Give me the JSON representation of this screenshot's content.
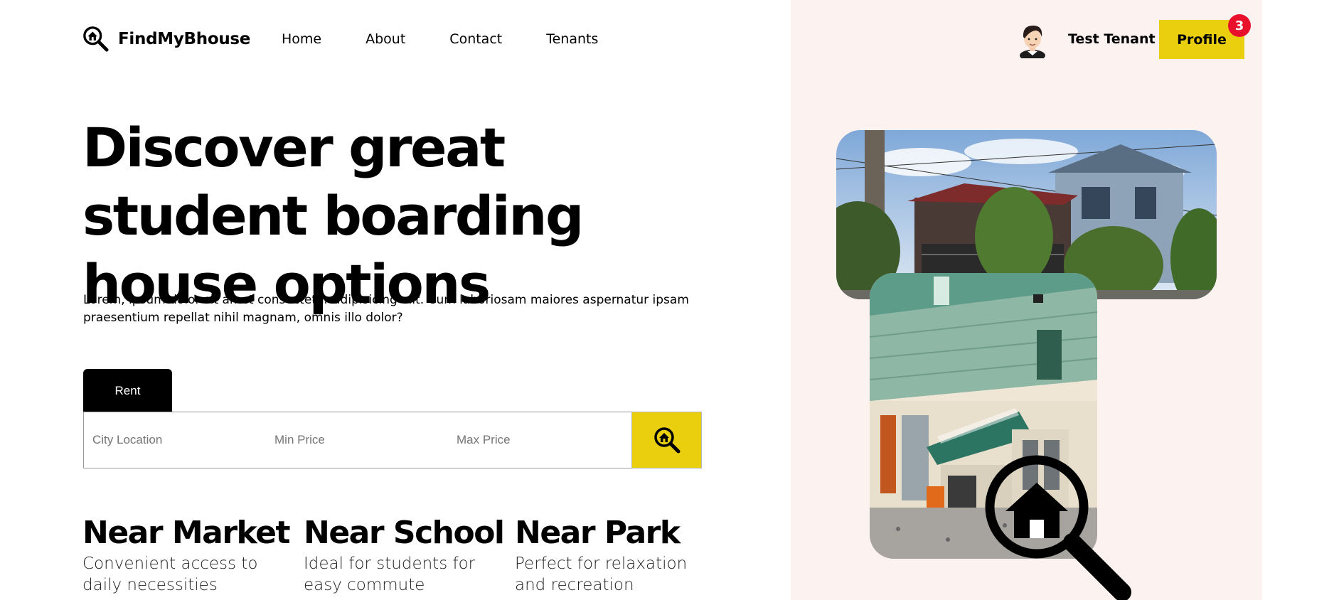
{
  "brand": {
    "name": "FindMyBhouse",
    "icon": "house-search-icon"
  },
  "nav": {
    "items": [
      "Home",
      "About",
      "Contact",
      "Tenants"
    ]
  },
  "user": {
    "name": "Test Tenant",
    "avatar": "avatar-icon",
    "profile_label": "Profile",
    "notification_count": "3"
  },
  "hero": {
    "headline": "Discover great student boarding house options",
    "description": "Lorem, ipsum dolor sit amet consectetur adipisicing elit. Cum laboriosam maiores aspernatur ipsam praesentium repellat nihil magnam, omnis illo dolor?"
  },
  "search": {
    "tab_label": "Rent",
    "city_placeholder": "City Location",
    "min_placeholder": "Min Price",
    "max_placeholder": "Max Price",
    "button_icon": "house-search-icon"
  },
  "features": [
    {
      "title": "Near Market",
      "description": "Convenient access to daily necessities"
    },
    {
      "title": "Near School",
      "description": "Ideal for students for easy commute"
    },
    {
      "title": "Near Park",
      "description": "Perfect for relaxation and recreation"
    }
  ],
  "images": {
    "top": "house-exterior-photo",
    "bottom": "boarding-house-porch-photo"
  },
  "colors": {
    "accent": "#e9cf0e",
    "badge": "#e8102a",
    "panel": "#fcf3f1"
  }
}
